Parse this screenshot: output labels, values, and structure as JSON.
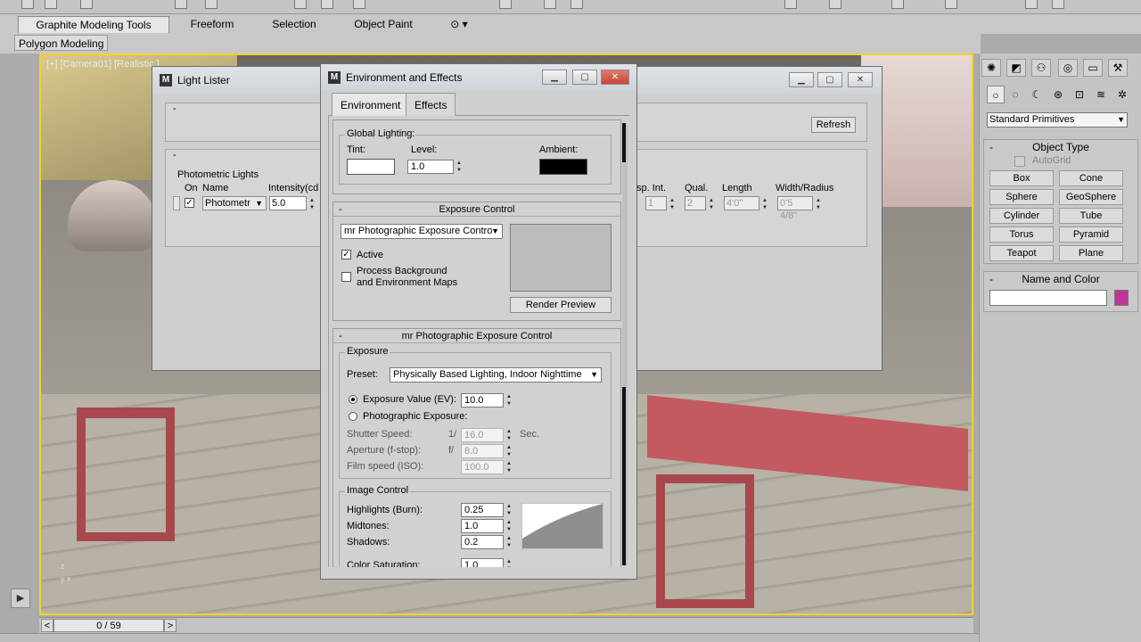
{
  "ribbon": {
    "tabs": [
      "Graphite Modeling Tools",
      "Freeform",
      "Selection",
      "Object Paint"
    ],
    "panel_label": "Polygon Modeling"
  },
  "viewport": {
    "label": "[+] [Camera01] [Realistic ]",
    "axis_z": "z",
    "axis_y": "y",
    "axis_x": "x"
  },
  "time_slider": {
    "value": "0 / 59",
    "prev": "<",
    "next": ">"
  },
  "command_panel": {
    "dropdown": "Standard Primitives",
    "object_type": {
      "title": "Object Type",
      "autogrid": "AutoGrid",
      "buttons": [
        "Box",
        "Cone",
        "Sphere",
        "GeoSphere",
        "Cylinder",
        "Tube",
        "Torus",
        "Pyramid",
        "Teapot",
        "Plane"
      ]
    },
    "name_and_color": {
      "title": "Name and Color",
      "name": "",
      "color": "#c0349a"
    }
  },
  "light_lister": {
    "title": "Light Lister",
    "refresh": "Refresh",
    "group_title": "Photometric Lights",
    "columns": {
      "on": "On",
      "name": "Name",
      "intensity": "Intensity(cd",
      "disp_int": "sp. Int.",
      "qual": "Qual.",
      "length": "Length",
      "width_radius": "Width/Radius"
    },
    "row": {
      "name": "Photometr",
      "intensity": "5.0",
      "disp_int": "1",
      "qual": "2",
      "length": "4'0\"",
      "width_radius": "0'5 4/8\""
    }
  },
  "env_effects": {
    "title": "Environment and Effects",
    "tabs": [
      "Environment",
      "Effects"
    ],
    "global_lighting": {
      "title": "Global Lighting:",
      "tint_label": "Tint:",
      "level_label": "Level:",
      "level_value": "1.0",
      "ambient_label": "Ambient:"
    },
    "exposure_control": {
      "title": "Exposure Control",
      "dropdown": "mr Photographic Exposure Contro",
      "active_label": "Active",
      "process_bg_line1": "Process Background",
      "process_bg_line2": "and Environment Maps",
      "render_preview": "Render Preview"
    },
    "mr_photographic": {
      "title": "mr Photographic Exposure Control",
      "exposure_group": "Exposure",
      "preset_label": "Preset:",
      "preset_value": "Physically Based Lighting, Indoor Nighttime",
      "ev_label": "Exposure Value (EV):",
      "ev_value": "10.0",
      "photographic_label": "Photographic Exposure:",
      "shutter_label": "Shutter Speed:",
      "shutter_prefix": "1/",
      "shutter_value": "16.0",
      "shutter_unit": "Sec.",
      "aperture_label": "Aperture (f-stop):",
      "aperture_prefix": "f/",
      "aperture_value": "8.0",
      "film_label": "Film speed (ISO):",
      "film_value": "100.0",
      "image_control_group": "Image Control",
      "highlights_label": "Highlights (Burn):",
      "highlights_value": "0.25",
      "midtones_label": "Midtones:",
      "midtones_value": "1.0",
      "shadows_label": "Shadows:",
      "shadows_value": "0.2",
      "saturation_label": "Color Saturation:",
      "saturation_value": "1.0"
    }
  },
  "colors": {
    "viewport_border": "#f3d22a",
    "ambient": "#000000",
    "tint": "#ffffff",
    "object_color": "#c0349a"
  }
}
